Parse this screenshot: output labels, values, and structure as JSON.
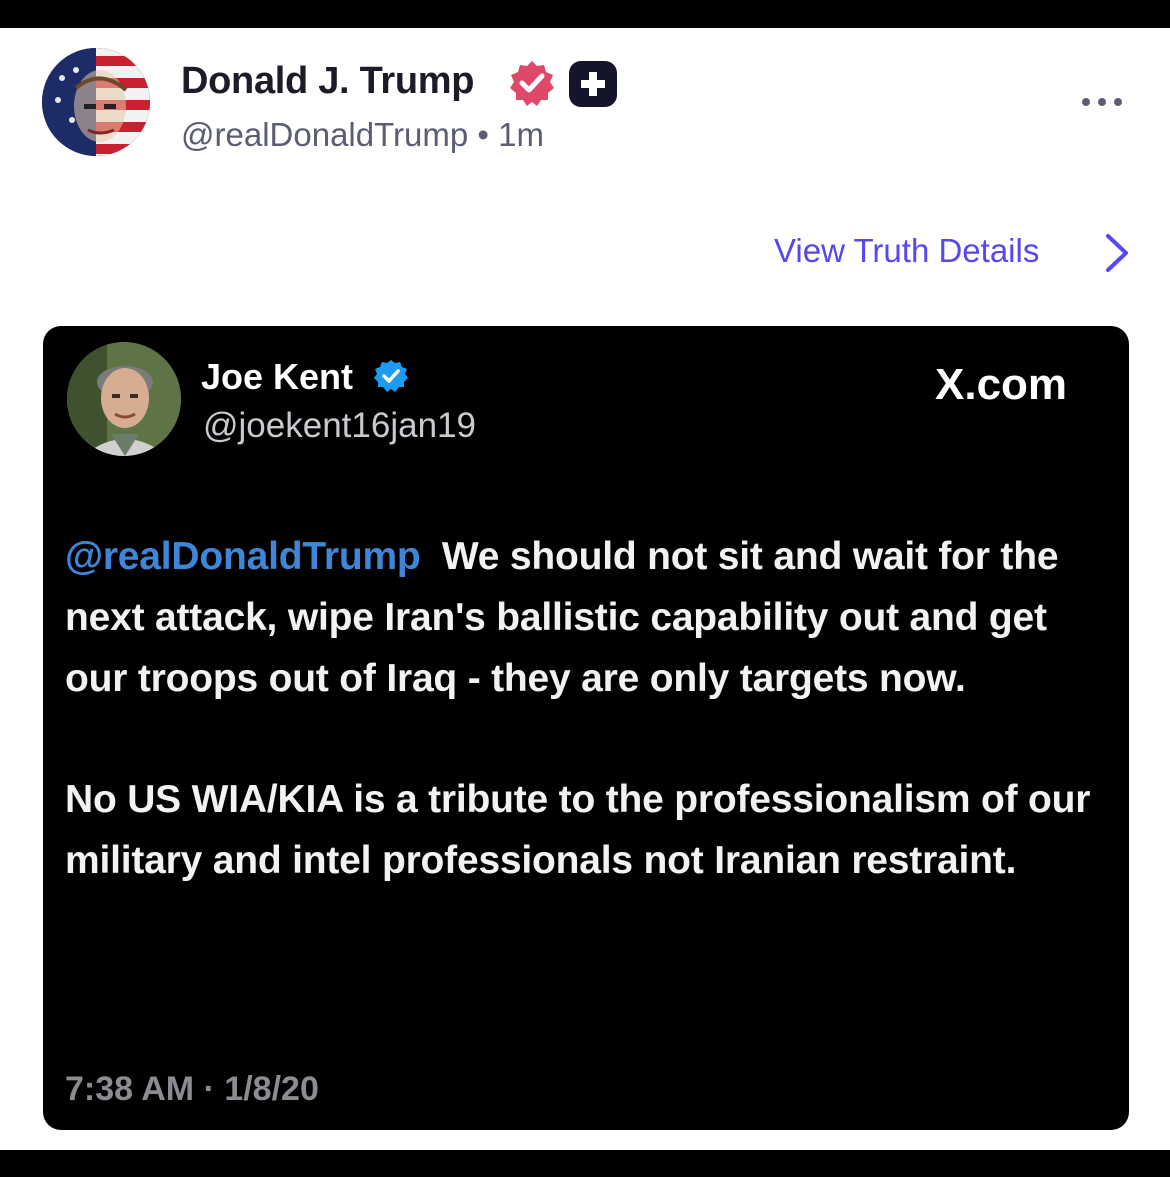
{
  "truth_post": {
    "author_name": "Donald J. Trump",
    "handle": "@realDonaldTrump",
    "separator": "•",
    "time_ago": "1m",
    "view_details_label": "View Truth Details",
    "more_label": "..."
  },
  "embedded_post": {
    "author_name": "Joe Kent",
    "handle": "@joekent16jan19",
    "source": "X.com",
    "mention": "@realDonaldTrump",
    "paragraph1_rest": "We should not sit and wait for the next attack, wipe Iran's ballistic capability out and get our troops out of Iraq - they are only targets now.",
    "paragraph2": "No US WIA/KIA is a tribute to the professionalism of our military and intel professionals not Iranian restraint.",
    "timestamp": "7:38 AM · 1/8/20"
  },
  "colors": {
    "verified_pink": "#e0486a",
    "link_purple": "#5448ee",
    "mention_blue": "#3d86d8",
    "x_verified_blue": "#1d9bf0"
  },
  "icons": {
    "verified": "verified-badge-icon",
    "plus": "plus-badge-icon",
    "more": "more-icon",
    "chevron": "chevron-right-icon"
  }
}
